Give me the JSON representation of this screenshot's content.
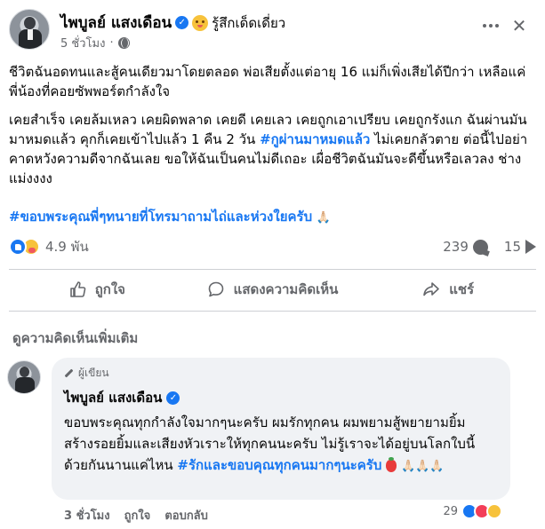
{
  "post": {
    "author": "ไพบูลย์ แสงเดือน",
    "feeling": "รู้สึกเด็ดเดี่ยว",
    "time": "5 ชั่วโมง",
    "paragraph1": "ชีวิตฉันอดทนและสู้คนเดียวมาโดยตลอด พ่อเสียตั้งแต่อายุ 16 แม่ก็เพิ่งเสียได้ปีกว่า เหลือแค่พี่น้องที่คอยซัพพอร์ตกำลังใจ",
    "paragraph2_a": "เคยสำเร็จ เคยล้มเหลว เคยผิดพลาด เคยดี เคยเลว เคยถูกเอาเปรียบ เคยถูกรังแก ฉันผ่านมันมาหมดแล้ว คุกก็เคยเข้าไปแล้ว 1 คืน 2 วัน ",
    "paragraph2_hashtag": "#กูผ่านมาหมดแล้ว",
    "paragraph2_b": " ไม่เคยกลัวตาย ต่อนี้ไปอย่าคาดหวังความดีจากฉันเลย ขอให้ฉันเป็นคนไม่ดีเถอะ เผื่อชีวิตฉันมันจะดีขึ้นหรือเลวลง ช่างแม่งงงง",
    "hashtag_line": "#ขอบพระคุณพี่ๆทนายที่โทรมาถามไถ่และห่วงใยครับ",
    "hashtag_emoji": "🙏🏻"
  },
  "stats": {
    "reactions": "4.9 พัน",
    "comments": "239",
    "shares": "15"
  },
  "actions": {
    "like": "ถูกใจ",
    "comment": "แสดงความคิดเห็น",
    "share": "แชร์"
  },
  "more_comments": "ดูความคิดเห็นเพิ่มเติม",
  "comment": {
    "badge": "ผู้เขียน",
    "author": "ไพบูลย์ แสงเดือน",
    "text_a": "ขอบพระคุณทุกกำลังใจมากๆนะครับ ผมรักทุกคน ผมพยามสู้พยายามยิ้ม สร้างรอยยิ้มและเสียงหัวเราะให้ทุกคนนะครับ ไม่รู้เราจะได้อยู่บนโลกใบนี้ด้วยกันนานแค่ไหน ",
    "text_hashtag": "#รักและขอบคุณทุกคนมากๆนะครับ",
    "text_emoji": "🙏🏻🙏🏻🙏🏻",
    "time": "3 ชั่วโมง",
    "like": "ถูกใจ",
    "reply": "ตอบกลับ",
    "reaction_count": "29"
  },
  "colors": {
    "accent": "#1877f2",
    "muted": "#65676b",
    "bubble": "#f0f2f5"
  },
  "icons": [
    "verified-icon",
    "globe-icon",
    "more-icon",
    "close-icon",
    "like-icon",
    "comment-icon",
    "share-icon",
    "pencil-icon"
  ]
}
